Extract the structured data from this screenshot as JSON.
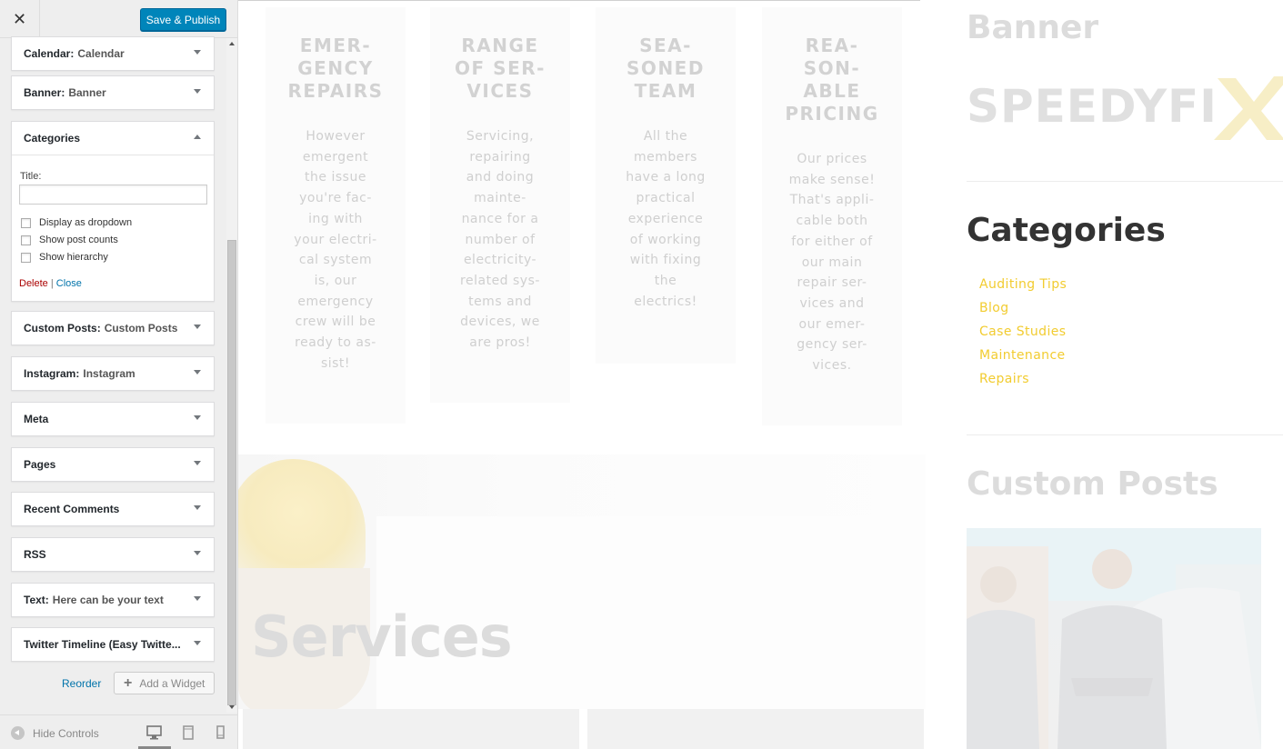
{
  "customizer": {
    "close_icon": "close-icon",
    "publish_label": "Save & Publish",
    "widgets": [
      {
        "type": "Calendar",
        "name": "Calendar",
        "expanded": false
      },
      {
        "type": "Banner",
        "name": "Banner",
        "expanded": false
      },
      {
        "type": "Categories",
        "name": "",
        "expanded": true
      },
      {
        "type": "Custom Posts",
        "name": "Custom Posts",
        "expanded": false
      },
      {
        "type": "Instagram",
        "name": "Instagram",
        "expanded": false
      },
      {
        "type": "Meta",
        "name": "",
        "expanded": false
      },
      {
        "type": "Pages",
        "name": "",
        "expanded": false
      },
      {
        "type": "Recent Comments",
        "name": "",
        "expanded": false
      },
      {
        "type": "RSS",
        "name": "",
        "expanded": false
      },
      {
        "type": "Text",
        "name": "Here can be your text",
        "expanded": false
      },
      {
        "type": "Twitter Timeline (Easy Twitte...",
        "name": "",
        "expanded": false
      }
    ],
    "categories_form": {
      "title_label": "Title:",
      "title_value": "",
      "options": [
        {
          "label": "Display as dropdown",
          "checked": false
        },
        {
          "label": "Show post counts",
          "checked": false
        },
        {
          "label": "Show hierarchy",
          "checked": false
        }
      ],
      "delete_label": "Delete",
      "separator": "|",
      "close_label": "Close"
    },
    "reorder_label": "Reorder",
    "add_widget_label": "Add a Widget",
    "hide_controls_label": "Hide Controls",
    "devices": [
      "desktop-icon",
      "tablet-icon",
      "mobile-icon"
    ],
    "active_device": "desktop"
  },
  "preview": {
    "features": [
      {
        "title": "EMER-\nGENCY\nREPAIRS",
        "text": "However\nemergent\nthe issue\nyou're fac-\ning with\nyour electri-\ncal system\nis, our\nemergency\ncrew will be\nready to as-\nsist!"
      },
      {
        "title": "RANGE\nOF SER-\nVICES",
        "text": "Servicing,\nrepairing\nand doing\nmainte-\nnance for a\nnumber of\nelectricity-\nrelated sys-\ntems and\ndevices, we\nare pros!"
      },
      {
        "title": "SEA-\nSONED\nTEAM",
        "text": "All the\nmembers\nhave a long\npractical\nexperience\nof working\nwith fixing\nthe\nelectrics!"
      },
      {
        "title": "REA-\nSON-\nABLE\nPRICING",
        "text": "Our prices\nmake sense!\nThat's appli-\ncable both\nfor either of\nour main\nrepair ser-\nvices and\nour emer-\ngency ser-\nvices."
      }
    ],
    "services_title": "Services",
    "sidebar": {
      "banner_heading": "Banner",
      "logo_text": "SPEEDYFI",
      "categories_heading": "Categories",
      "categories": [
        "Auditing Tips",
        "Blog",
        "Case Studies",
        "Maintenance",
        "Repairs"
      ],
      "custom_posts_heading": "Custom Posts"
    }
  },
  "colors": {
    "publish_blue": "#0085ba",
    "link_blue": "#0073aa",
    "delete_red": "#aa0000",
    "category_yellow": "#f2cc30",
    "logo_x_yellow": "#f7eec6"
  }
}
